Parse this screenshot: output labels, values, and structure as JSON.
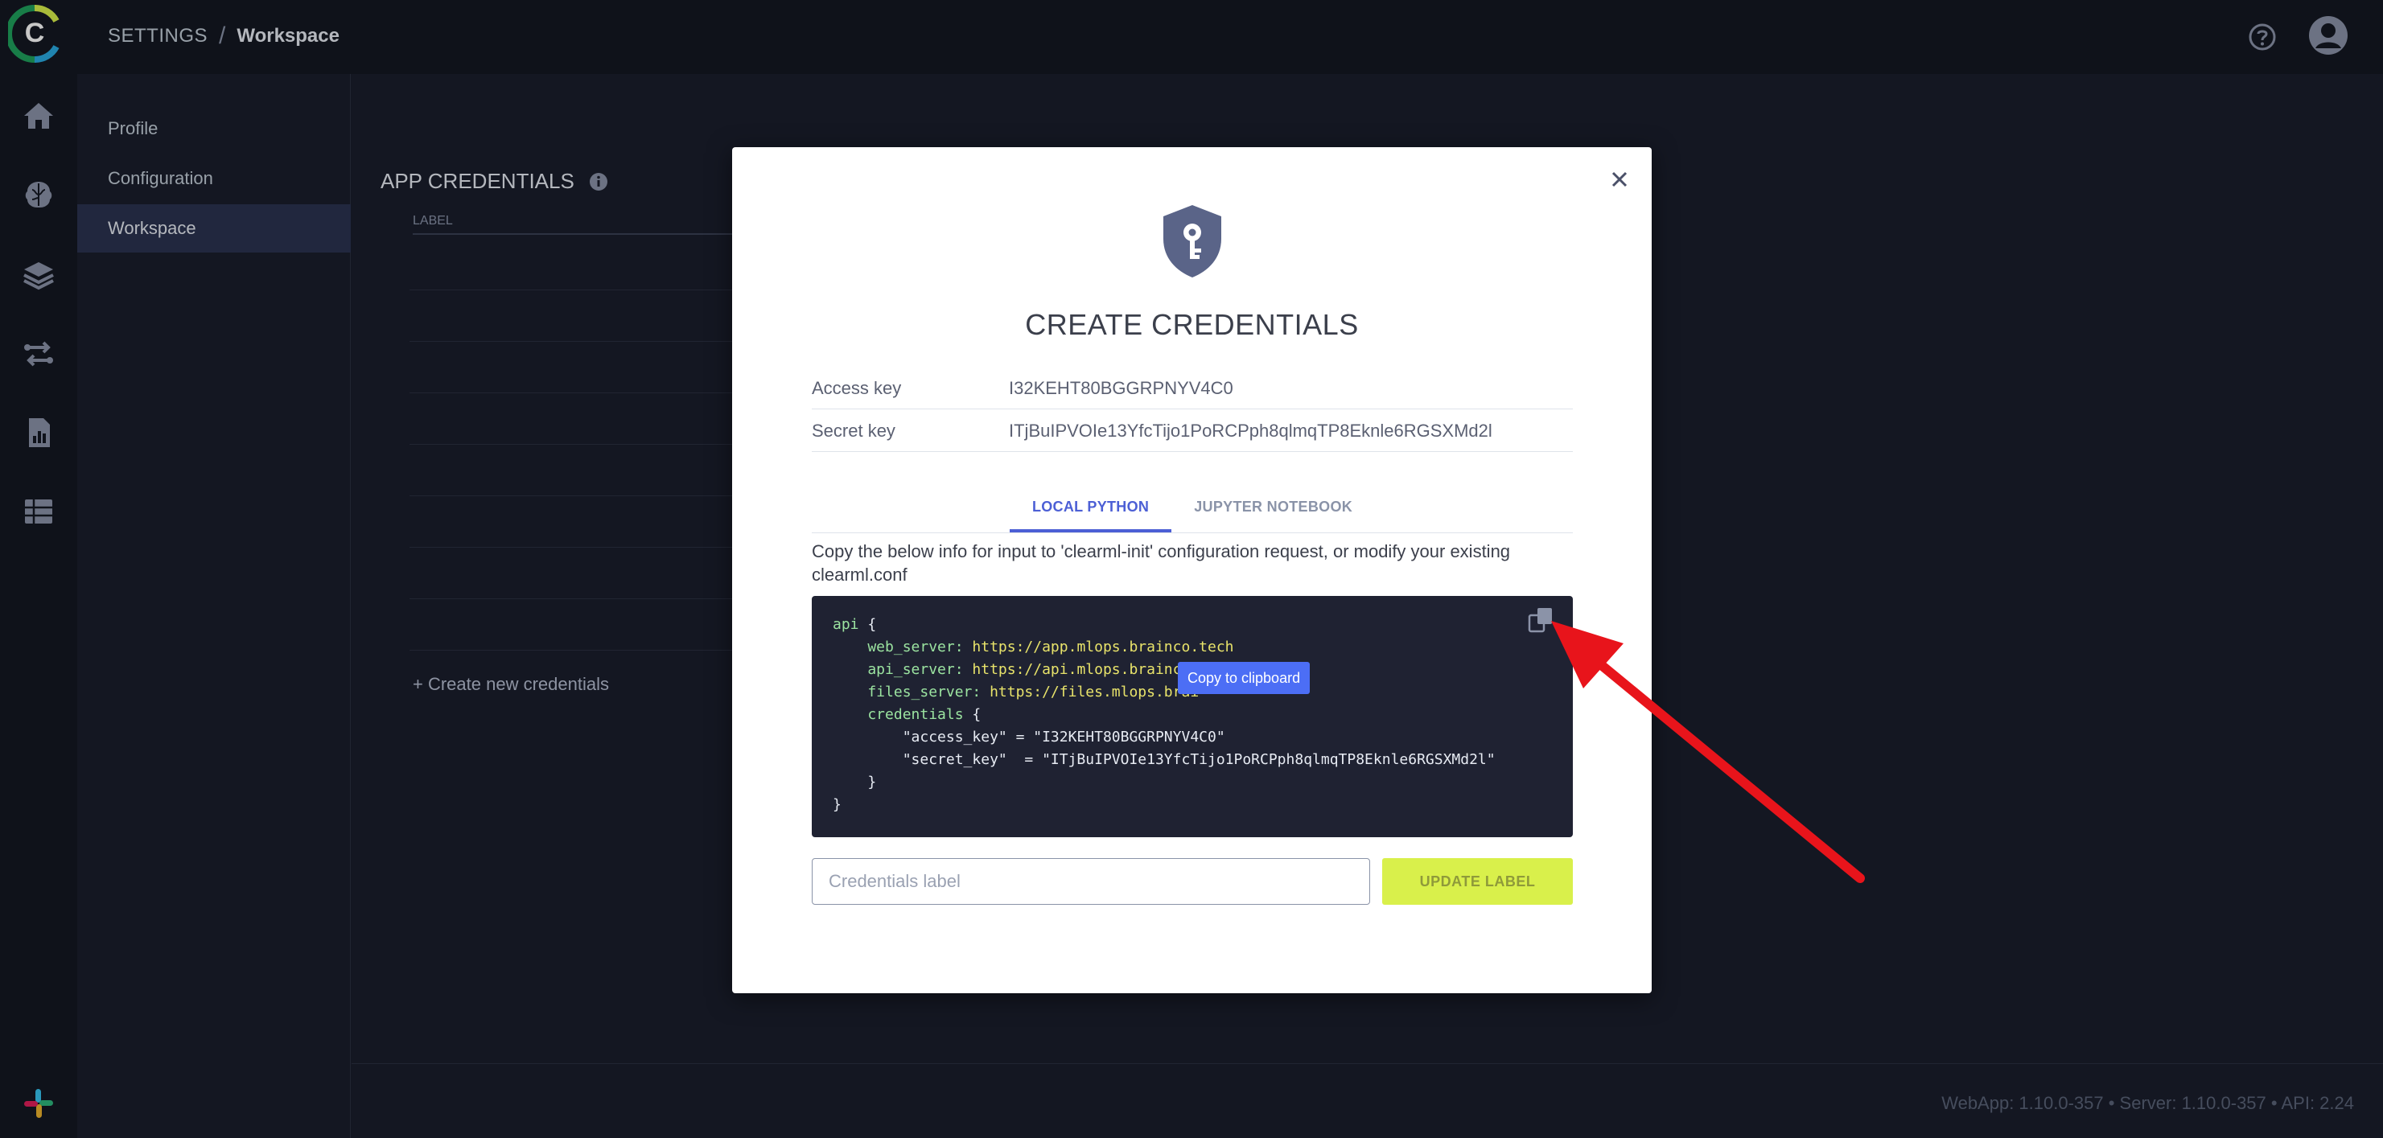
{
  "topbar": {
    "breadcrumb_root": "SETTINGS",
    "breadcrumb_separator": "/",
    "breadcrumb_current": "Workspace"
  },
  "rail": {
    "icons": [
      "clearml-logo-icon",
      "home-icon",
      "brain-icon",
      "layers-icon",
      "pipelines-icon",
      "reports-icon",
      "datasets-icon",
      "slack-icon"
    ]
  },
  "subnav": {
    "items": [
      {
        "label": "Profile"
      },
      {
        "label": "Configuration"
      },
      {
        "label": "Workspace"
      }
    ],
    "active_index": 2
  },
  "main": {
    "section_title": "APP CREDENTIALS",
    "column_label": "LABEL",
    "create_link": "+ Create new credentials"
  },
  "footer": {
    "version": "WebApp: 1.10.0-357 • Server: 1.10.0-357 • API: 2.24"
  },
  "modal": {
    "title": "CREATE CREDENTIALS",
    "access_key_label": "Access key",
    "access_key_value": "I32KEHT80BGGRPNYV4C0",
    "secret_key_label": "Secret key",
    "secret_key_value": "ITjBuIPVOIe13YfcTijo1PoRCPph8qlmqTP8Eknle6RGSXMd2l",
    "tabs": [
      {
        "label": "LOCAL PYTHON"
      },
      {
        "label": "JUPYTER NOTEBOOK"
      }
    ],
    "active_tab_index": 0,
    "description": "Copy the below info for input to 'clearml-init' configuration request, or modify your existing clearml.conf",
    "code": {
      "l1_key": "api",
      "l1_rest": " {",
      "web_key": "    web_server:",
      "web_val": " https://app.mlops.brainco.tech",
      "api_key": "    api_server:",
      "api_val": " https://api.mlops.brainco.",
      "files_key": "    files_server:",
      "files_val": " https://files.mlops.brai",
      "cred_key": "    credentials",
      "cred_rest": " {",
      "ak_line": "        \"access_key\" = \"I32KEHT80BGGRPNYV4C0\"",
      "sk_line": "        \"secret_key\"  = \"ITjBuIPVOIe13YfcTijo1PoRCPph8qlmqTP8Eknle6RGSXMd2l\"",
      "close_inner": "    }",
      "close_outer": "}"
    },
    "tooltip": "Copy to clipboard",
    "label_placeholder": "Credentials label",
    "update_button": "UPDATE LABEL"
  },
  "colors": {
    "accent": "#4c5fd5",
    "update_button_bg": "#d9f04b",
    "annotation_arrow": "#e8141b",
    "code_bg": "#1f2232"
  }
}
